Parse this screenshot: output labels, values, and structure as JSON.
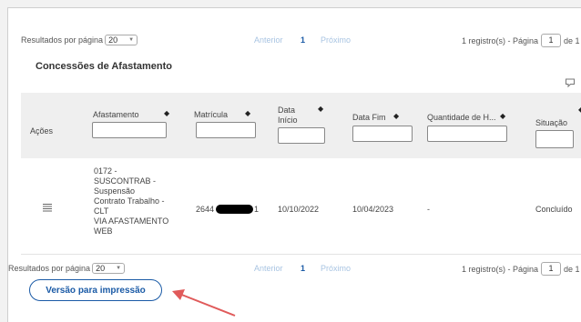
{
  "pager": {
    "per_page_label": "Resultados por página",
    "per_page_value": "20",
    "prev_label": "Anterior",
    "current_page": "1",
    "next_label": "Próximo",
    "records_label": "1 registro(s) - Página",
    "page_input_value": "1",
    "of_label": "de 1"
  },
  "section": {
    "title": "Concessões de Afastamento"
  },
  "table": {
    "headers": {
      "acoes": "Ações",
      "afastamento": "Afastamento",
      "matricula": "Matrícula",
      "data_inicio_line1": "Data",
      "data_inicio_line2": "Início",
      "data_fim": "Data Fim",
      "quantidade": "Quantidade de H...",
      "situacao": "Situação"
    },
    "row": {
      "afastamento_lines": [
        "0172 -",
        "SUSCONTRAB -",
        "Suspensão",
        "Contrato Trabalho -",
        "CLT",
        "VIA AFASTAMENTO",
        "WEB"
      ],
      "matricula_prefix": "2644",
      "matricula_suffix": "1",
      "data_inicio": "10/10/2022",
      "data_fim": "10/04/2023",
      "quantidade": "-",
      "situacao": "Concluído"
    }
  },
  "print_button_label": "Versão para impressão",
  "colors": {
    "accent": "#1a5aa6",
    "annotation_arrow": "#e05a5a"
  },
  "icons": {
    "actions": "menu-lines-icon",
    "comment": "comment-icon"
  }
}
